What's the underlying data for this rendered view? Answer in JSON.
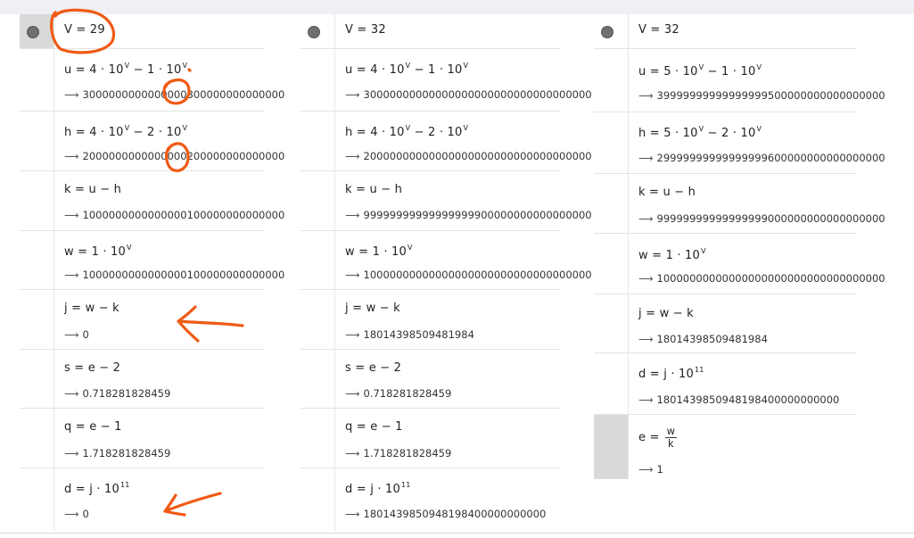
{
  "panels": [
    {
      "header": "V = 29",
      "rows": [
        {
          "formula_a": "u = 4 · 10",
          "sup_a": "V",
          "formula_b": " − 1 · 10",
          "sup_b": "V",
          "value": "3000000000000000300000000000000"
        },
        {
          "formula_a": "h = 4 · 10",
          "sup_a": "V",
          "formula_b": " − 2 · 10",
          "sup_b": "V",
          "value": "2000000000000000200000000000000"
        },
        {
          "formula": "k = u − h",
          "value": "1000000000000000100000000000000"
        },
        {
          "formula_a": "w = 1 · 10",
          "sup_a": "V",
          "value": "1000000000000000100000000000000"
        },
        {
          "formula": "j = w − k",
          "value": "0"
        },
        {
          "formula": "s = e − 2",
          "value": "0.718281828459"
        },
        {
          "formula": "q = e − 1",
          "value": "1.718281828459"
        },
        {
          "formula_a": "d = j · 10",
          "sup_a": "11",
          "value": "0"
        }
      ]
    },
    {
      "header": "V = 32",
      "rows": [
        {
          "formula_a": "u = 4 · 10",
          "sup_a": "V",
          "formula_b": " − 1 · 10",
          "sup_b": "V",
          "value": "30000000000000000000000000000000000"
        },
        {
          "formula_a": "h = 4 · 10",
          "sup_a": "V",
          "formula_b": " − 2 · 10",
          "sup_b": "V",
          "value": "20000000000000000000000000000000000"
        },
        {
          "formula": "k = u − h",
          "value": "99999999999999999900000000000000000"
        },
        {
          "formula_a": "w = 1 · 10",
          "sup_a": "V",
          "value": "10000000000000000000000000000000000"
        },
        {
          "formula": "j = w − k",
          "value": "18014398509481984"
        },
        {
          "formula": "s = e − 2",
          "value": "0.718281828459"
        },
        {
          "formula": "q = e − 1",
          "value": "1.718281828459"
        },
        {
          "formula_a": "d = j · 10",
          "sup_a": "11",
          "value": "1801439850948198400000000000"
        }
      ]
    },
    {
      "header": "V = 32",
      "rows": [
        {
          "formula_a": "u = 5 · 10",
          "sup_a": "V",
          "formula_b": " − 1 · 10",
          "sup_b": "V",
          "value": "39999999999999999500000000000000000"
        },
        {
          "formula_a": "h = 5 · 10",
          "sup_a": "V",
          "formula_b": " − 2 · 10",
          "sup_b": "V",
          "value": "29999999999999999600000000000000000"
        },
        {
          "formula": "k = u − h",
          "value": "99999999999999999000000000000000000"
        },
        {
          "formula_a": "w = 1 · 10",
          "sup_a": "V",
          "value": "10000000000000000000000000000000000"
        },
        {
          "formula": "j = w − k",
          "value": "18014398509481984"
        },
        {
          "formula_a": "d = j · 10",
          "sup_a": "11",
          "value": "1801439850948198400000000000"
        },
        {
          "formula_pre": "e =",
          "frac_num": "w",
          "frac_den": "k",
          "value": "1"
        }
      ]
    }
  ],
  "arrow_glyph": "⟶",
  "annotation_color": "#f05a14"
}
